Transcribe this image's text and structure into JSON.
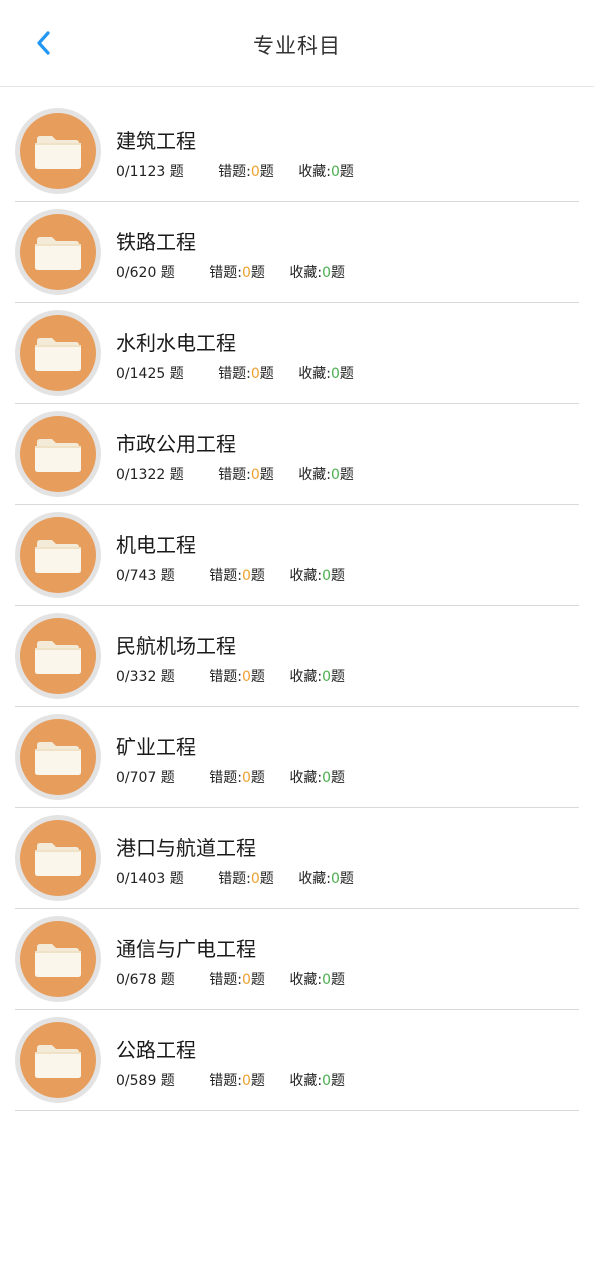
{
  "header": {
    "title": "专业科目"
  },
  "labels": {
    "question_unit": "题",
    "wrong_label": "错题:",
    "fav_label": "收藏:"
  },
  "colors": {
    "accent_blue": "#2196f3",
    "folder_orange": "#e79d5c",
    "wrong_count": "#f0a030",
    "fav_count": "#4caf50"
  },
  "subjects": [
    {
      "name": "建筑工程",
      "progress": "0/1123 题",
      "wrong": "0",
      "fav": "0"
    },
    {
      "name": "铁路工程",
      "progress": "0/620 题",
      "wrong": "0",
      "fav": "0"
    },
    {
      "name": "水利水电工程",
      "progress": "0/1425 题",
      "wrong": "0",
      "fav": "0"
    },
    {
      "name": "市政公用工程",
      "progress": "0/1322 题",
      "wrong": "0",
      "fav": "0"
    },
    {
      "name": "机电工程",
      "progress": "0/743 题",
      "wrong": "0",
      "fav": "0"
    },
    {
      "name": "民航机场工程",
      "progress": "0/332 题",
      "wrong": "0",
      "fav": "0"
    },
    {
      "name": "矿业工程",
      "progress": "0/707 题",
      "wrong": "0",
      "fav": "0"
    },
    {
      "name": "港口与航道工程",
      "progress": "0/1403 题",
      "wrong": "0",
      "fav": "0"
    },
    {
      "name": "通信与广电工程",
      "progress": "0/678 题",
      "wrong": "0",
      "fav": "0"
    },
    {
      "name": "公路工程",
      "progress": "0/589 题",
      "wrong": "0",
      "fav": "0"
    }
  ],
  "icons": {
    "back": "chevron-left-icon",
    "subject": "folder-icon"
  }
}
